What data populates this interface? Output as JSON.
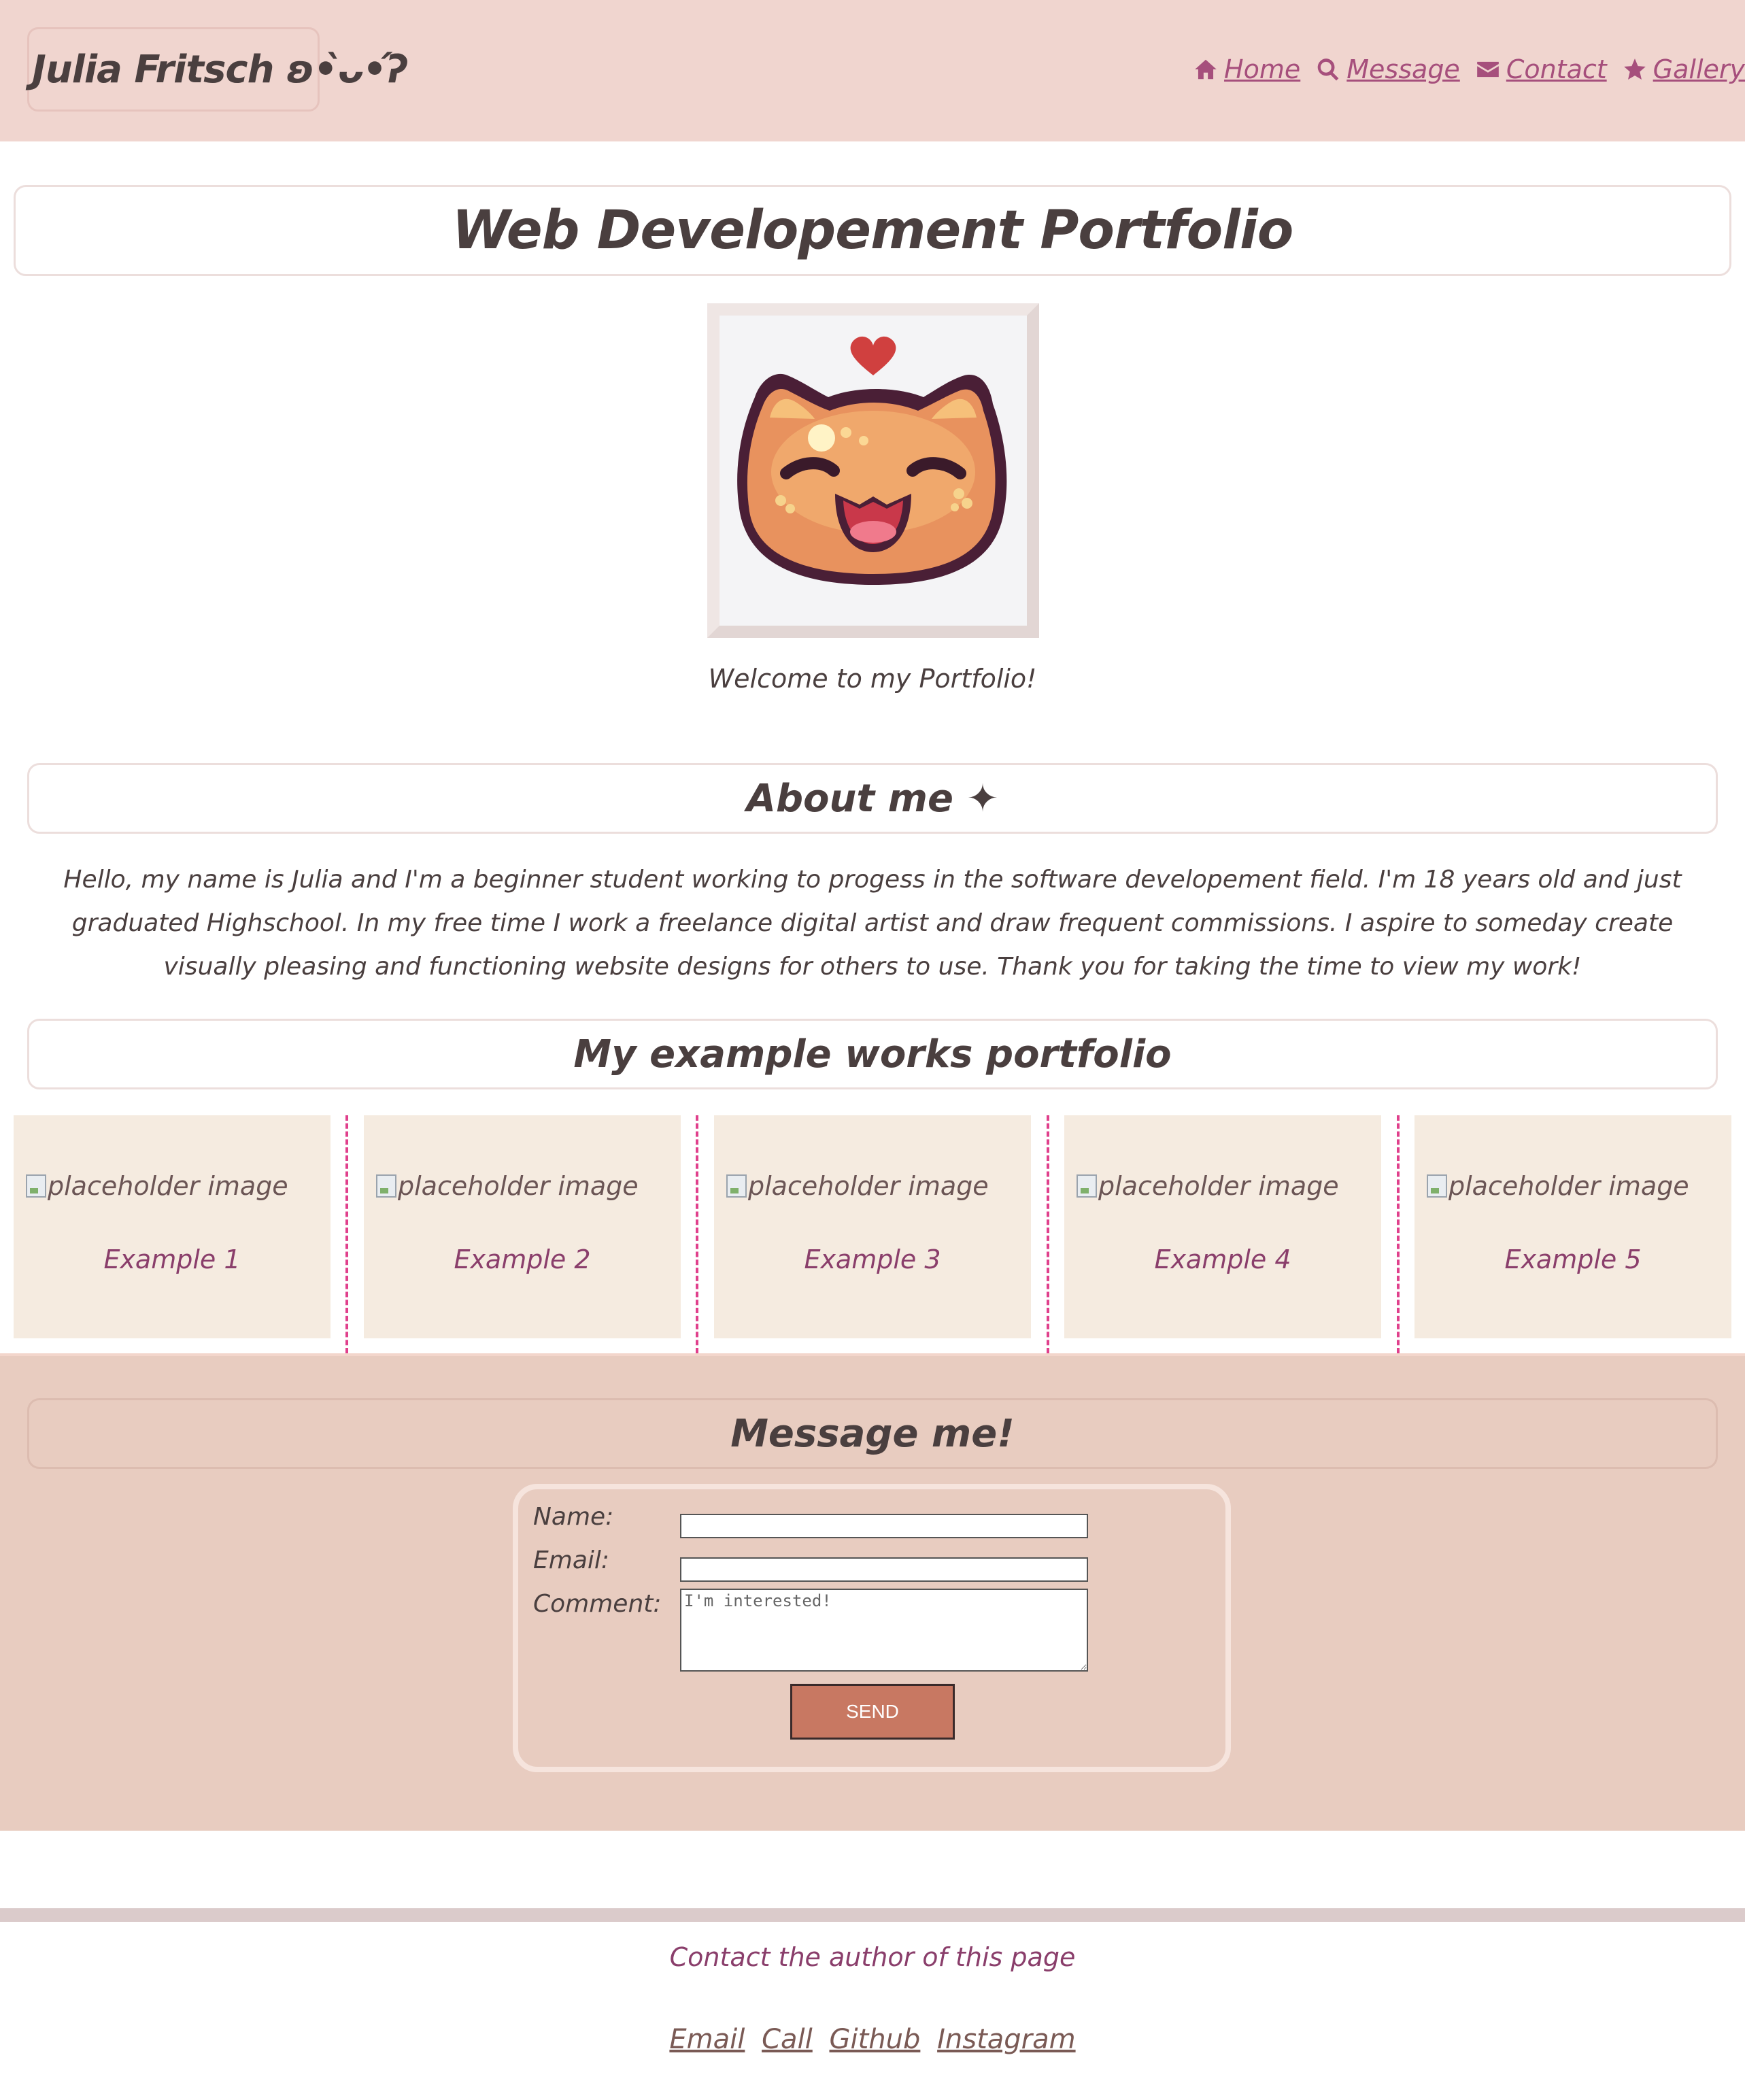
{
  "header": {
    "logo": "Julia Fritsch ʚ•̀ᴗ•́ʔ",
    "nav": [
      {
        "label": " Home",
        "icon": "home-icon"
      },
      {
        "label": " Message",
        "icon": "search-icon"
      },
      {
        "label": " Contact",
        "icon": "envelope-icon"
      },
      {
        "label": "Gallery",
        "icon": "star-icon"
      }
    ]
  },
  "title": "Web Developement Portfolio",
  "welcome": "Welcome to my Portfolio!",
  "about": {
    "heading": "About me ✦",
    "text": "Hello, my name is Julia and I'm a beginner student working to progess in the software developement field. I'm 18 years old and just graduated Highschool. In my free time I work a freelance digital artist and draw frequent commissions. I aspire to someday create visually pleasing and functioning website designs for others to use. Thank you for taking the time to view my work!"
  },
  "works": {
    "heading": "My example works portfolio",
    "items": [
      {
        "alt": "placeholder image",
        "caption": "Example 1"
      },
      {
        "alt": "placeholder image",
        "caption": "Example 2"
      },
      {
        "alt": "placeholder image",
        "caption": "Example 3"
      },
      {
        "alt": "placeholder image",
        "caption": "Example 4"
      },
      {
        "alt": "placeholder image",
        "caption": "Example 5"
      }
    ]
  },
  "message": {
    "heading": "Message me!",
    "name_label": "Name:",
    "email_label": "Email:",
    "comment_label": "Comment:",
    "comment_placeholder": "I'm interested!",
    "send_label": "SEND"
  },
  "footer": {
    "text": "Contact the author of this page",
    "links": [
      "Email",
      "Call",
      "Github",
      "Instagram"
    ]
  },
  "colors": {
    "header_bg": "#f0d5cf",
    "accent": "#a64f7c",
    "card_bg": "#f5ebe0",
    "message_bg": "#e8ccc0",
    "send_button": "#c87862"
  }
}
